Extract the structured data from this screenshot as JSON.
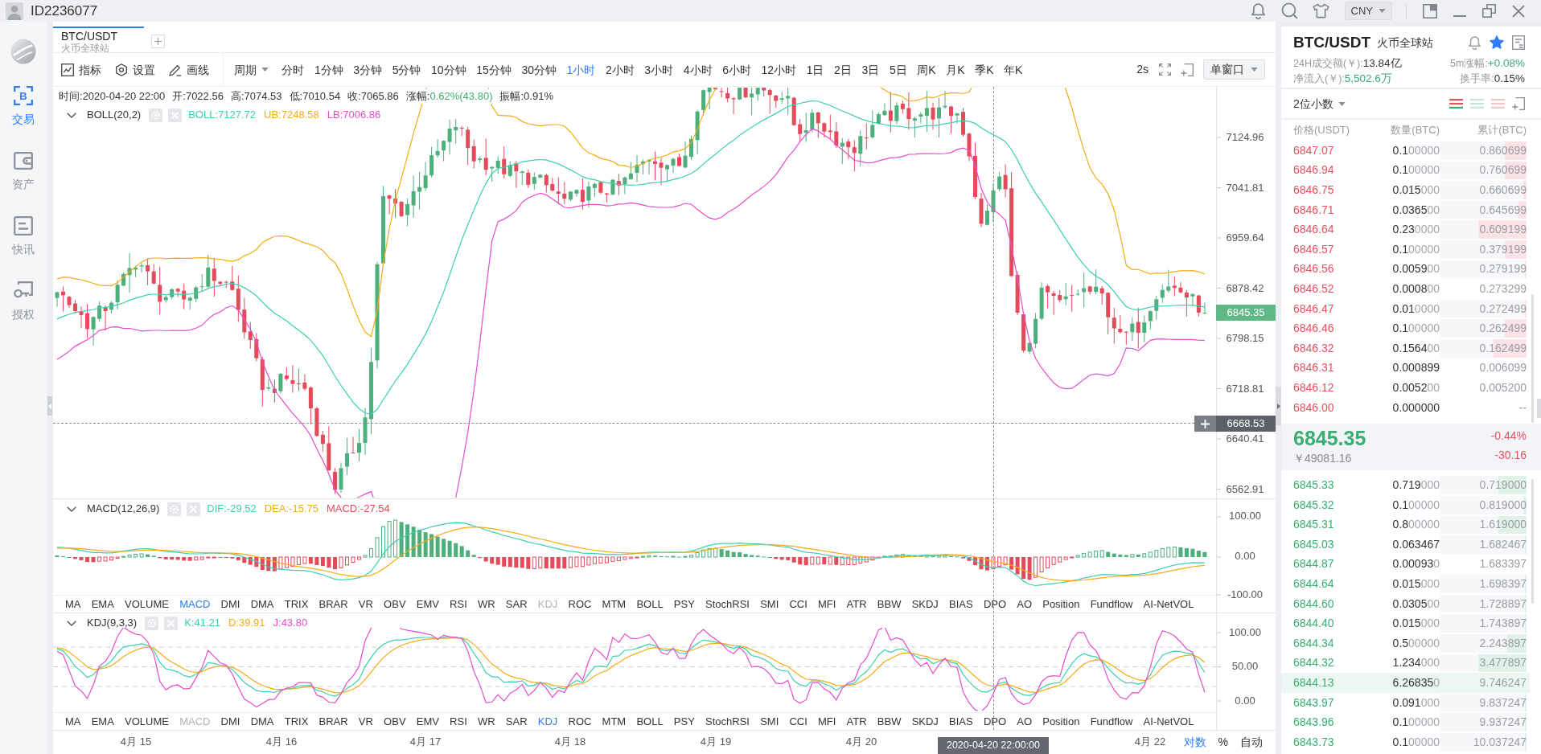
{
  "titlebar": {
    "user_id": "ID2236077",
    "currency": "CNY"
  },
  "sidebar": {
    "items": [
      {
        "label": "交易",
        "glyph": "B",
        "selected": true
      },
      {
        "label": "资产",
        "selected": false
      },
      {
        "label": "快讯",
        "selected": false
      },
      {
        "label": "授权",
        "selected": false
      }
    ]
  },
  "tabs": [
    {
      "title": "BTC/USDT",
      "subtitle": "火币全球站",
      "selected": true
    }
  ],
  "toolbar": {
    "tools": [
      "指标",
      "设置",
      "画线"
    ],
    "period_menu": "周期",
    "periods": [
      {
        "label": "分时",
        "selected": false
      },
      {
        "label": "1分钟",
        "selected": false
      },
      {
        "label": "3分钟",
        "selected": false
      },
      {
        "label": "5分钟",
        "selected": false
      },
      {
        "label": "10分钟",
        "selected": false
      },
      {
        "label": "15分钟",
        "selected": false
      },
      {
        "label": "30分钟",
        "selected": false
      },
      {
        "label": "1小时",
        "selected": true
      },
      {
        "label": "2小时",
        "selected": false
      },
      {
        "label": "3小时",
        "selected": false
      },
      {
        "label": "4小时",
        "selected": false
      },
      {
        "label": "6小时",
        "selected": false
      },
      {
        "label": "12小时",
        "selected": false
      },
      {
        "label": "1日",
        "selected": false
      },
      {
        "label": "2日",
        "selected": false
      },
      {
        "label": "3日",
        "selected": false
      },
      {
        "label": "5日",
        "selected": false
      },
      {
        "label": "周K",
        "selected": false
      },
      {
        "label": "月K",
        "selected": false
      },
      {
        "label": "季K",
        "selected": false
      },
      {
        "label": "年K",
        "selected": false
      }
    ],
    "refresh_interval": "2s",
    "window_mode": "单窗口"
  },
  "main_chart": {
    "ohlc": [
      {
        "label": "时间:",
        "value": "2020-04-20 22:00"
      },
      {
        "label": "开:",
        "value": "7022.56"
      },
      {
        "label": "高:",
        "value": "7074.53"
      },
      {
        "label": "低:",
        "value": "7010.54"
      },
      {
        "label": "收:",
        "value": "7065.86"
      },
      {
        "label": "涨幅:",
        "value": "0.62%(43.80)",
        "color": "#3cad72"
      },
      {
        "label": "振幅:",
        "value": "0.91%"
      }
    ],
    "indicator": "BOLL(20,2)",
    "legend": [
      {
        "label": "BOLL:7127.72",
        "color": "#3ccfb0"
      },
      {
        "label": "UB:7248.58",
        "color": "#f5ab15"
      },
      {
        "label": "LB:7006.86",
        "color": "#e64dce"
      }
    ],
    "price_axis": [
      "7124.96",
      "7041.81",
      "6959.64",
      "6878.42",
      "6798.15",
      "6718.81",
      "6640.41",
      "6562.91"
    ],
    "last_price": "6845.35",
    "crosshair_price": "6668.53"
  },
  "macd_pane": {
    "indicator": "MACD(12,26,9)",
    "legend": [
      {
        "label": "DIF:-29.52",
        "color": "#3ccfb0"
      },
      {
        "label": "DEA:-15.75",
        "color": "#f5ab15"
      },
      {
        "label": "MACD:-27.54",
        "color": "#e34b5b"
      }
    ],
    "axis": [
      "100.00",
      "0.00",
      "-100.00"
    ],
    "indicators": [
      {
        "label": "MA",
        "selected": false,
        "disabled": false
      },
      {
        "label": "EMA",
        "selected": false,
        "disabled": false
      },
      {
        "label": "VOLUME",
        "selected": false,
        "disabled": false
      },
      {
        "label": "MACD",
        "selected": true,
        "disabled": false
      },
      {
        "label": "DMI",
        "selected": false,
        "disabled": false
      },
      {
        "label": "DMA",
        "selected": false,
        "disabled": false
      },
      {
        "label": "TRIX",
        "selected": false,
        "disabled": false
      },
      {
        "label": "BRAR",
        "selected": false,
        "disabled": false
      },
      {
        "label": "VR",
        "selected": false,
        "disabled": false
      },
      {
        "label": "OBV",
        "selected": false,
        "disabled": false
      },
      {
        "label": "EMV",
        "selected": false,
        "disabled": false
      },
      {
        "label": "RSI",
        "selected": false,
        "disabled": false
      },
      {
        "label": "WR",
        "selected": false,
        "disabled": false
      },
      {
        "label": "SAR",
        "selected": false,
        "disabled": false
      },
      {
        "label": "KDJ",
        "selected": false,
        "disabled": true
      },
      {
        "label": "ROC",
        "selected": false,
        "disabled": false
      },
      {
        "label": "MTM",
        "selected": false,
        "disabled": false
      },
      {
        "label": "BOLL",
        "selected": false,
        "disabled": false
      },
      {
        "label": "PSY",
        "selected": false,
        "disabled": false
      },
      {
        "label": "StochRSI",
        "selected": false,
        "disabled": false
      },
      {
        "label": "SMI",
        "selected": false,
        "disabled": false
      },
      {
        "label": "CCI",
        "selected": false,
        "disabled": false
      },
      {
        "label": "MFI",
        "selected": false,
        "disabled": false
      },
      {
        "label": "ATR",
        "selected": false,
        "disabled": false
      },
      {
        "label": "BBW",
        "selected": false,
        "disabled": false
      },
      {
        "label": "SKDJ",
        "selected": false,
        "disabled": false
      },
      {
        "label": "BIAS",
        "selected": false,
        "disabled": false
      },
      {
        "label": "DPO",
        "selected": false,
        "disabled": false
      },
      {
        "label": "AO",
        "selected": false,
        "disabled": false
      },
      {
        "label": "Position",
        "selected": false,
        "disabled": false
      },
      {
        "label": "Fundflow",
        "selected": false,
        "disabled": false
      },
      {
        "label": "AI-NetVOL",
        "selected": false,
        "disabled": false
      }
    ]
  },
  "kdj_pane": {
    "indicator": "KDJ(9,3,3)",
    "legend": [
      {
        "label": "K:41.21",
        "color": "#3ccfb0"
      },
      {
        "label": "D:39.91",
        "color": "#f5ab15"
      },
      {
        "label": "J:43.80",
        "color": "#e64dce"
      }
    ],
    "axis": [
      "100.00",
      "50.00",
      "0.00"
    ],
    "indicators": [
      {
        "label": "MA",
        "selected": false,
        "disabled": false
      },
      {
        "label": "EMA",
        "selected": false,
        "disabled": false
      },
      {
        "label": "VOLUME",
        "selected": false,
        "disabled": false
      },
      {
        "label": "MACD",
        "selected": false,
        "disabled": true
      },
      {
        "label": "DMI",
        "selected": false,
        "disabled": false
      },
      {
        "label": "DMA",
        "selected": false,
        "disabled": false
      },
      {
        "label": "TRIX",
        "selected": false,
        "disabled": false
      },
      {
        "label": "BRAR",
        "selected": false,
        "disabled": false
      },
      {
        "label": "VR",
        "selected": false,
        "disabled": false
      },
      {
        "label": "OBV",
        "selected": false,
        "disabled": false
      },
      {
        "label": "EMV",
        "selected": false,
        "disabled": false
      },
      {
        "label": "RSI",
        "selected": false,
        "disabled": false
      },
      {
        "label": "WR",
        "selected": false,
        "disabled": false
      },
      {
        "label": "SAR",
        "selected": false,
        "disabled": false
      },
      {
        "label": "KDJ",
        "selected": true,
        "disabled": false
      },
      {
        "label": "ROC",
        "selected": false,
        "disabled": false
      },
      {
        "label": "MTM",
        "selected": false,
        "disabled": false
      },
      {
        "label": "BOLL",
        "selected": false,
        "disabled": false
      },
      {
        "label": "PSY",
        "selected": false,
        "disabled": false
      },
      {
        "label": "StochRSI",
        "selected": false,
        "disabled": false
      },
      {
        "label": "SMI",
        "selected": false,
        "disabled": false
      },
      {
        "label": "CCI",
        "selected": false,
        "disabled": false
      },
      {
        "label": "MFI",
        "selected": false,
        "disabled": false
      },
      {
        "label": "ATR",
        "selected": false,
        "disabled": false
      },
      {
        "label": "BBW",
        "selected": false,
        "disabled": false
      },
      {
        "label": "SKDJ",
        "selected": false,
        "disabled": false
      },
      {
        "label": "BIAS",
        "selected": false,
        "disabled": false
      },
      {
        "label": "DPO",
        "selected": false,
        "disabled": false
      },
      {
        "label": "AO",
        "selected": false,
        "disabled": false
      },
      {
        "label": "Position",
        "selected": false,
        "disabled": false
      },
      {
        "label": "Fundflow",
        "selected": false,
        "disabled": false
      },
      {
        "label": "AI-NetVOL",
        "selected": false,
        "disabled": false
      }
    ]
  },
  "time_axis": {
    "labels": [
      "4月 15",
      "4月 16",
      "4月 17",
      "4月 18",
      "4月 19",
      "4月 20",
      "4月 22"
    ],
    "crosshair_time": "2020-04-20 22:00:00",
    "scale_modes": [
      {
        "label": "对数",
        "selected": true
      },
      {
        "label": "%",
        "selected": false
      },
      {
        "label": "自动",
        "selected": false
      }
    ]
  },
  "order_book": {
    "symbol": "BTC/USDT",
    "exchange": "火币全球站",
    "favorite": true,
    "stats": [
      {
        "label": "24H成交额(￥):",
        "value": "13.84亿"
      },
      {
        "label": "5m涨幅:",
        "value": "+0.08%",
        "color": "#3cad72"
      },
      {
        "label": "净流入(￥):",
        "value": "5,502.6万",
        "color": "#3cad72"
      },
      {
        "label": "换手率:",
        "value": "0.15%"
      }
    ],
    "precision": "2位小数",
    "views": [
      {
        "selected": true
      },
      {
        "selected": false
      },
      {
        "selected": false
      }
    ],
    "columns": [
      "价格(USDT)",
      "数量(BTC)",
      "累计(BTC)"
    ],
    "asks": [
      {
        "price": "6847.07",
        "amount": "0.1",
        "amount_zeros": "00000",
        "total": "0.860699",
        "level": 0.25,
        "highlighted": false
      },
      {
        "price": "6846.94",
        "amount": "0.1",
        "amount_zeros": "00000",
        "total": "0.760699",
        "level": 0.25,
        "highlighted": false
      },
      {
        "price": "6846.75",
        "amount": "0.015",
        "amount_zeros": "000",
        "total": "0.660699",
        "level": 0.04,
        "highlighted": false
      },
      {
        "price": "6846.71",
        "amount": "0.0365",
        "amount_zeros": "00",
        "total": "0.645699",
        "level": 0.09,
        "highlighted": false
      },
      {
        "price": "6846.64",
        "amount": "0.23",
        "amount_zeros": "0000",
        "total": "0.609199",
        "level": 0.56,
        "highlighted": false
      },
      {
        "price": "6846.57",
        "amount": "0.1",
        "amount_zeros": "00000",
        "total": "0.379199",
        "level": 0.25,
        "highlighted": false
      },
      {
        "price": "6846.56",
        "amount": "0.0059",
        "amount_zeros": "00",
        "total": "0.279199",
        "level": 0.02,
        "highlighted": false
      },
      {
        "price": "6846.52",
        "amount": "0.0008",
        "amount_zeros": "00",
        "total": "0.273299",
        "highlighted": false
      },
      {
        "price": "6846.47",
        "amount": "0.01",
        "amount_zeros": "0000",
        "total": "0.272499",
        "level": 0.02,
        "highlighted": false
      },
      {
        "price": "6846.46",
        "amount": "0.1",
        "amount_zeros": "00000",
        "total": "0.262499",
        "level": 0.25,
        "highlighted": false
      },
      {
        "price": "6846.32",
        "amount": "0.1564",
        "amount_zeros": "00",
        "total": "0.162499",
        "level": 0.38,
        "highlighted": false
      },
      {
        "price": "6846.31",
        "amount": "0.000899",
        "total": "0.006099",
        "highlighted": false
      },
      {
        "price": "6846.12",
        "amount": "0.0052",
        "amount_zeros": "00",
        "total": "0.005200",
        "highlighted": false
      },
      {
        "price": "6846.00",
        "amount": "0.000000",
        "total": "--",
        "highlighted": false
      }
    ],
    "last_price": "6845.35",
    "last_price_cny": "￥49081.16",
    "change_percent": "-0.44%",
    "change": "-30.16",
    "bids": [
      {
        "price": "6845.33",
        "amount": "0.719",
        "amount_zeros": "000",
        "total": "0.719000",
        "level": 0.32,
        "highlighted": false
      },
      {
        "price": "6845.32",
        "amount": "0.1",
        "amount_zeros": "00000",
        "total": "0.819000",
        "level": 0.04,
        "highlighted": false
      },
      {
        "price": "6845.31",
        "amount": "0.8",
        "amount_zeros": "00000",
        "total": "1.619000",
        "level": 0.32,
        "highlighted": false
      },
      {
        "price": "6845.03",
        "amount": "0.063467",
        "total": "1.682467",
        "level": 0.02,
        "highlighted": false
      },
      {
        "price": "6844.87",
        "amount": "0.00093",
        "amount_zeros": "0",
        "total": "1.683397",
        "highlighted": false
      },
      {
        "price": "6844.64",
        "amount": "0.015",
        "amount_zeros": "000",
        "total": "1.698397",
        "level": 0.02,
        "highlighted": false
      },
      {
        "price": "6844.60",
        "amount": "0.0305",
        "amount_zeros": "00",
        "total": "1.728897",
        "level": 0.02,
        "highlighted": false
      },
      {
        "price": "6844.40",
        "amount": "0.015",
        "amount_zeros": "000",
        "total": "1.743897",
        "level": 0.02,
        "highlighted": false
      },
      {
        "price": "6844.34",
        "amount": "0.5",
        "amount_zeros": "00000",
        "total": "2.243897",
        "level": 0.22,
        "highlighted": false
      },
      {
        "price": "6844.32",
        "amount": "1.234",
        "amount_zeros": "000",
        "total": "3.477897",
        "level": 0.56,
        "highlighted": false
      },
      {
        "price": "6844.13",
        "amount": "6.26835",
        "amount_zeros": "0",
        "total": "9.746247",
        "highlighted": true
      },
      {
        "price": "6843.97",
        "amount": "0.091",
        "amount_zeros": "000",
        "total": "9.837247",
        "level": 0.02,
        "highlighted": false
      },
      {
        "price": "6843.96",
        "amount": "0.1",
        "amount_zeros": "00000",
        "total": "9.937247",
        "level": 0.02,
        "highlighted": false
      },
      {
        "price": "6843.73",
        "amount": "0.1",
        "amount_zeros": "00000",
        "total": "10.037247",
        "level": 0.02,
        "highlighted": false
      }
    ]
  }
}
